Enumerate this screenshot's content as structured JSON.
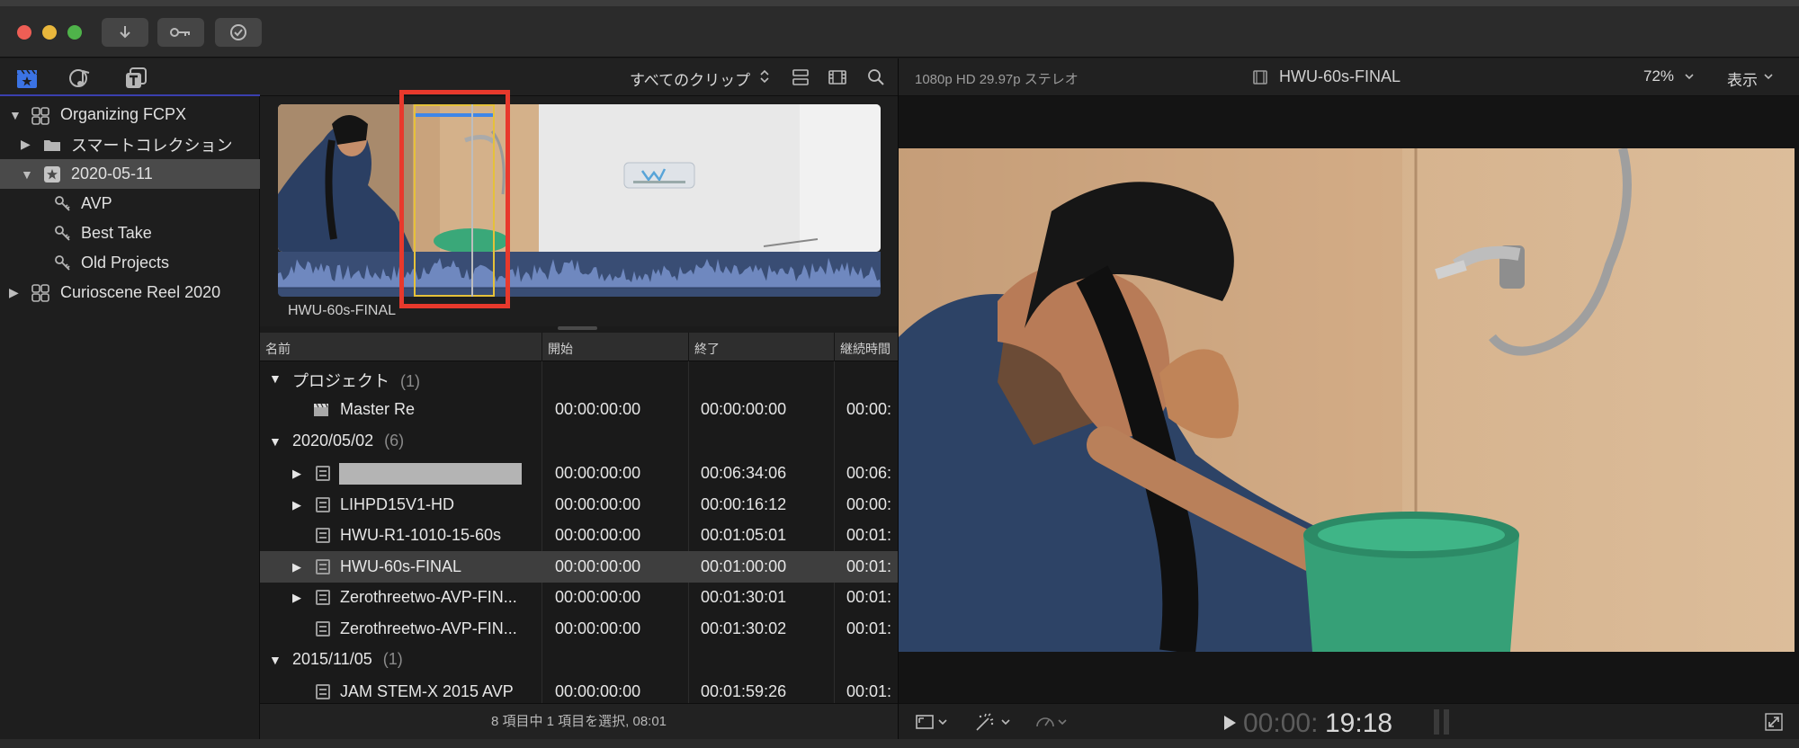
{
  "toolbar": {
    "buttons": [
      "import-icon",
      "key-icon",
      "checkmark-icon"
    ],
    "traffic_light_colors": [
      "#ee5e55",
      "#e9b73c",
      "#4fb34a"
    ]
  },
  "library_tabs": [
    "clapper-icon",
    "music-icon",
    "title-icon"
  ],
  "sidebar": {
    "items": [
      {
        "label": "Organizing FCPX",
        "level": 0,
        "expanded": true,
        "icon": "library-icon"
      },
      {
        "label": "スマートコレクション",
        "level": 1,
        "expanded": false,
        "icon": "folder-icon"
      },
      {
        "label": "2020-05-11",
        "level": 1,
        "expanded": true,
        "icon": "event-icon",
        "selected": true
      },
      {
        "label": "AVP",
        "level": 2,
        "icon": "keyword-icon"
      },
      {
        "label": "Best Take",
        "level": 2,
        "icon": "keyword-icon"
      },
      {
        "label": "Old Projects",
        "level": 2,
        "icon": "keyword-icon"
      },
      {
        "label": "Curioscene Reel 2020",
        "level": 0,
        "expanded": false,
        "icon": "library-icon"
      }
    ]
  },
  "browser": {
    "filter_label": "すべてのクリップ",
    "clip_name": "HWU-60s-FINAL"
  },
  "list": {
    "headers": [
      "名前",
      "開始",
      "終了",
      "継続時間"
    ],
    "rows": [
      {
        "type": "group",
        "name": "プロジェクト",
        "count": "(1)"
      },
      {
        "type": "item",
        "icon": "clapper-icon",
        "name": "Master Re",
        "start": "00:00:00:00",
        "end": "00:00:00:00",
        "duration": "00:00:"
      },
      {
        "type": "group",
        "name": "2020/05/02",
        "count": "(6)"
      },
      {
        "type": "item",
        "icon": "film-icon",
        "name": "",
        "redacted": true,
        "expandable": true,
        "start": "00:00:00:00",
        "end": "00:06:34:06",
        "duration": "00:06:"
      },
      {
        "type": "item",
        "icon": "film-icon",
        "name": "LIHPD15V1-HD",
        "expandable": true,
        "start": "00:00:00:00",
        "end": "00:00:16:12",
        "duration": "00:00:"
      },
      {
        "type": "item",
        "icon": "film-icon",
        "name": "HWU-R1-1010-15-60s",
        "start": "00:00:00:00",
        "end": "00:01:05:01",
        "duration": "00:01:"
      },
      {
        "type": "item",
        "icon": "film-icon",
        "name": "HWU-60s-FINAL",
        "expandable": true,
        "selected": true,
        "start": "00:00:00:00",
        "end": "00:01:00:00",
        "duration": "00:01:"
      },
      {
        "type": "item",
        "icon": "film-icon",
        "name": "Zerothreetwo-AVP-FIN...",
        "expandable": true,
        "start": "00:00:00:00",
        "end": "00:01:30:01",
        "duration": "00:01:"
      },
      {
        "type": "item",
        "icon": "film-icon",
        "name": "Zerothreetwo-AVP-FIN...",
        "start": "00:00:00:00",
        "end": "00:01:30:02",
        "duration": "00:01:"
      },
      {
        "type": "group",
        "name": "2015/11/05",
        "count": "(1)"
      },
      {
        "type": "item",
        "icon": "film-icon",
        "name": "JAM STEM-X 2015 AVP",
        "start": "00:00:00:00",
        "end": "00:01:59:26",
        "duration": "00:01:"
      }
    ],
    "status": "8 項目中 1 項目を選択, 08:01"
  },
  "viewer": {
    "format": "1080p HD 29.97p ステレオ",
    "title": "HWU-60s-FINAL",
    "zoom": "72%",
    "view_menu": "表示",
    "timecode_dim": "00:00:",
    "timecode_bright": "19:18"
  }
}
